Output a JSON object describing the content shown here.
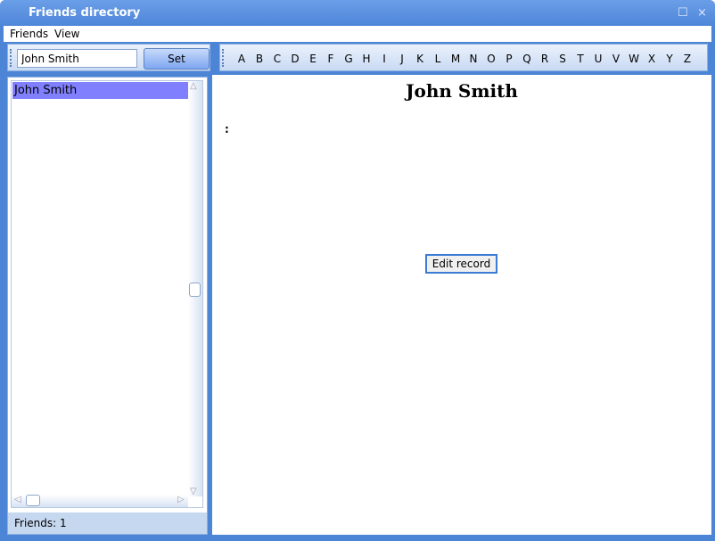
{
  "window": {
    "title": "Friends directory"
  },
  "menu": {
    "items": [
      "Friends",
      "View"
    ]
  },
  "toolbar": {
    "name_value": "John Smith",
    "set_label": "Set"
  },
  "alphabet": [
    "A",
    "B",
    "C",
    "D",
    "E",
    "F",
    "G",
    "H",
    "I",
    "J",
    "K",
    "L",
    "M",
    "N",
    "O",
    "P",
    "Q",
    "R",
    "S",
    "T",
    "U",
    "V",
    "W",
    "X",
    "Y",
    "Z"
  ],
  "list": {
    "items": [
      "John Smith"
    ],
    "selected_color": "#8080ff"
  },
  "status": {
    "text": "Friends: 1"
  },
  "detail": {
    "name": "John Smith",
    "field": ":",
    "edit_label": "Edit record"
  }
}
